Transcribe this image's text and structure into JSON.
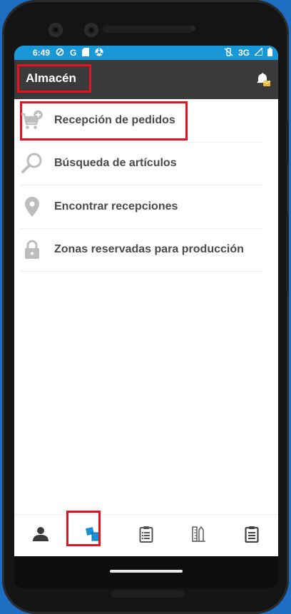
{
  "status_bar": {
    "time": "6:49",
    "network": "3G",
    "left_icons": [
      "vpn-icon",
      "google-icon",
      "sd-card-icon",
      "app-icon"
    ],
    "right_icons": [
      "vibrate-off-icon",
      "signal-icon",
      "battery-icon"
    ]
  },
  "app_bar": {
    "title": "Almacén",
    "action_icon": "notification-bell-icon"
  },
  "menu": {
    "items": [
      {
        "label": "Recepción de pedidos",
        "icon": "cart-add-icon"
      },
      {
        "label": "Búsqueda de artículos",
        "icon": "search-icon"
      },
      {
        "label": "Encontrar recepciones",
        "icon": "location-pin-icon"
      },
      {
        "label": "Zonas reservadas para producción",
        "icon": "lock-icon"
      }
    ]
  },
  "bottom_nav": {
    "items": [
      {
        "icon": "person-icon"
      },
      {
        "icon": "warehouse-boxes-icon",
        "active": true
      },
      {
        "icon": "clipboard-list-icon"
      },
      {
        "icon": "ruler-pencil-icon"
      },
      {
        "icon": "clipboard-icon"
      }
    ]
  },
  "colors": {
    "status_bar": "#1a97d6",
    "app_bar": "#3a3a3a",
    "highlight": "#e3141f",
    "active_icon": "#1a8fd6",
    "menu_text": "#4a4a4a"
  }
}
